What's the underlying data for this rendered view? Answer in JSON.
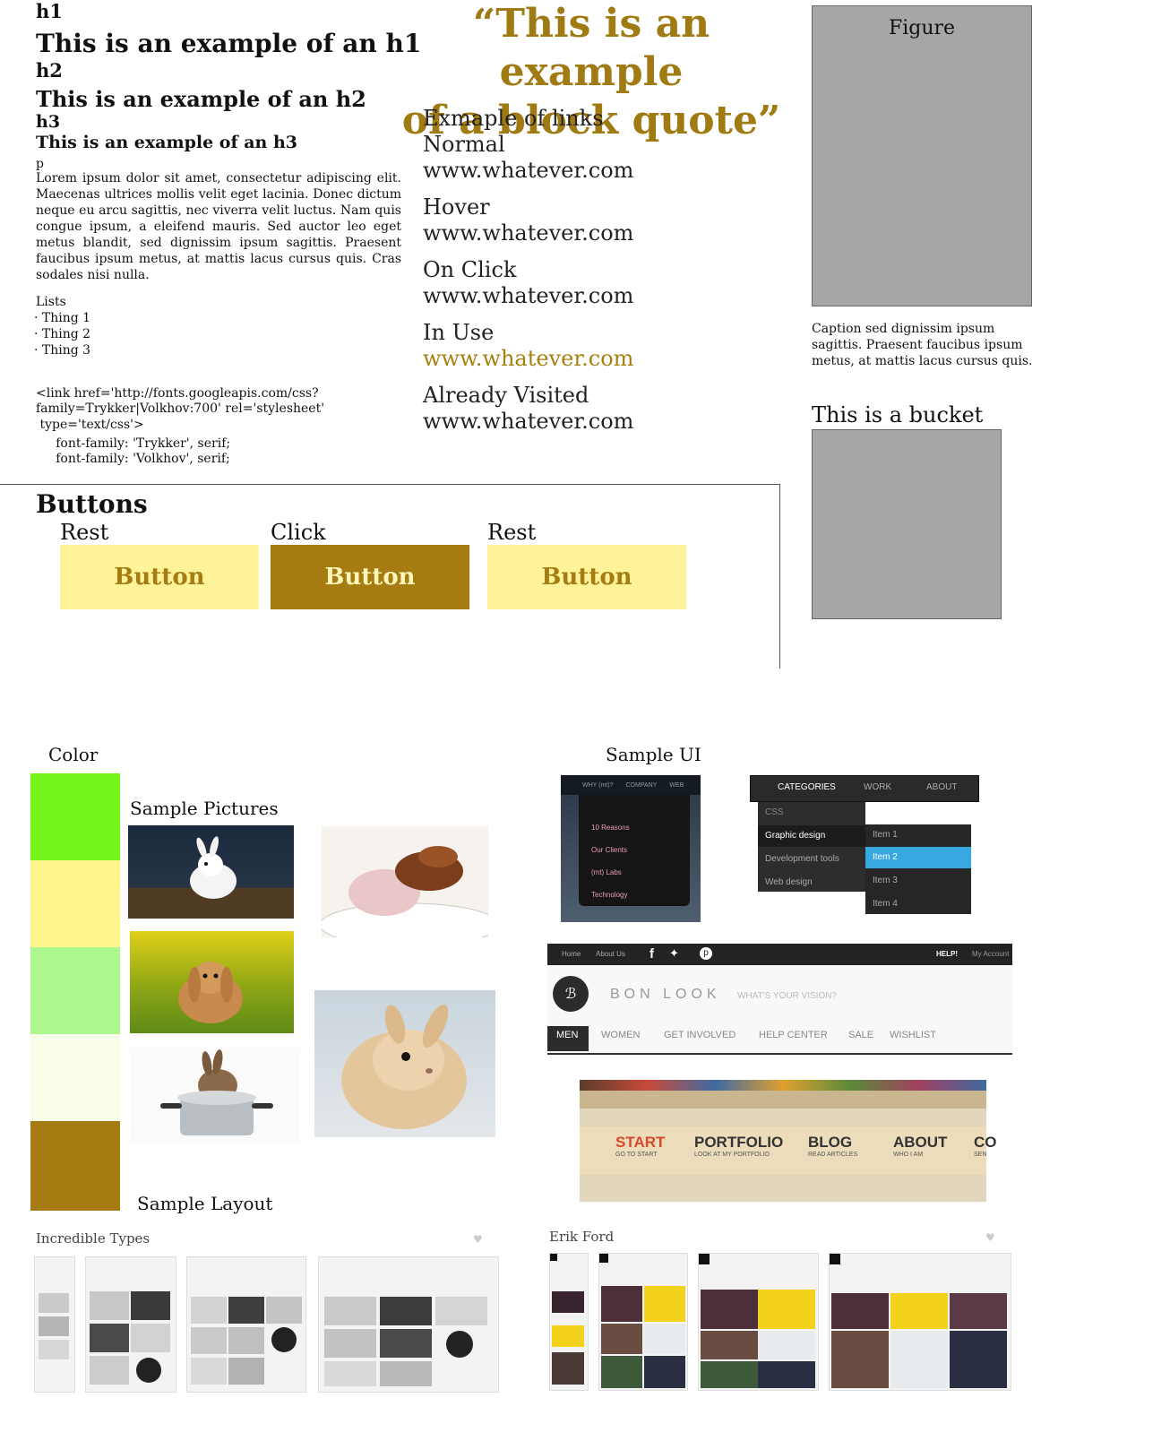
{
  "typography": {
    "h1_label": "h1",
    "h1_example": "This is an example of an h1",
    "h2_label": "h2",
    "h2_example": "This is an example of an h2",
    "h3_label": "h3",
    "h3_example": "This is an example of an h3",
    "p_label": "p",
    "paragraph": "Lorem ipsum dolor sit amet, consectetur adipiscing elit. Maecenas ultrices mollis velit eget lacinia. Donec dictum neque eu arcu sagittis, nec viverra velit luctus. Nam quis congue ipsum, a eleifend mauris. Sed auctor leo eget metus blandit, sed dignissim ipsum sagittis. Praesent faucibus ipsum metus, at mattis lacus cursus quis. Cras sodales nisi nulla.",
    "lists_label": "Lists",
    "list_items": [
      "· Thing 1",
      "· Thing 2",
      "· Thing 3"
    ],
    "code_lines": [
      "<link href='http://fonts.googleapis.com/css?",
      "family=Trykker|Volkhov:700' rel='stylesheet'",
      " type='text/css'>",
      "     font-family: 'Trykker', serif;",
      "     font-family: 'Volkhov', serif;"
    ]
  },
  "quote": {
    "line1": "“This is an example",
    "line2": "of a block quote”"
  },
  "links": {
    "heading": "Exmaple of links",
    "states": [
      {
        "label": "Normal",
        "url": "www.whatever.com"
      },
      {
        "label": "Hover",
        "url": "www.whatever.com"
      },
      {
        "label": "On Click",
        "url": "www.whatever.com"
      },
      {
        "label": "In Use",
        "url": "www.whatever.com"
      },
      {
        "label": "Already Visited",
        "url": "www.whatever.com"
      }
    ]
  },
  "figure": {
    "label": "Figure",
    "caption": "Caption sed dignissim ipsum sagittis. Praesent faucibus ipsum metus, at mattis lacus cursus quis.",
    "bucket_title": "This is a bucket"
  },
  "buttons": {
    "heading": "Buttons",
    "items": [
      {
        "state": "Rest",
        "label": "Button"
      },
      {
        "state": "Click",
        "label": "Button"
      },
      {
        "state": "Rest",
        "label": "Button"
      }
    ],
    "colors": {
      "rest_bg": "#fff399",
      "rest_text": "#a57c13",
      "click_bg": "#a67c12",
      "click_text": "#fff6b8"
    }
  },
  "color": {
    "label": "Color",
    "swatches": [
      "#74f51a",
      "#fff58f",
      "#adf78f",
      "#f8fde9",
      "#a67c12"
    ]
  },
  "pictures": {
    "label": "Sample Pictures"
  },
  "sample_ui": {
    "label": "Sample UI",
    "dropdown1": {
      "tabs": [
        "WHY (mt)?",
        "COMPANY",
        "WEB"
      ],
      "items": [
        "10 Reasons",
        "Our Clients",
        "(mt) Labs",
        "Technology"
      ]
    },
    "dropdown2": {
      "tabs": [
        "CATEGORIES",
        "WORK",
        "ABOUT"
      ],
      "items": [
        "CSS",
        "Graphic design",
        "Development tools",
        "Web design"
      ],
      "sub_items": [
        "Item 1",
        "Item 2",
        "Item 3",
        "Item 4"
      ]
    },
    "bonlook": {
      "top_links": [
        "Home",
        "About Us"
      ],
      "right_links": [
        "HELP!",
        "My Account"
      ],
      "brand": "BON LOOK",
      "tagline": "WHAT'S YOUR VISION?",
      "nav": [
        "MEN",
        "WOMEN",
        "GET INVOLVED",
        "HELP CENTER",
        "SALE",
        "WISHLIST"
      ]
    },
    "paper_nav": [
      {
        "title": "START",
        "sub": "GO TO START"
      },
      {
        "title": "PORTFOLIO",
        "sub": "LOOK AT MY PORTFOLIO"
      },
      {
        "title": "BLOG",
        "sub": "READ ARTICLES"
      },
      {
        "title": "ABOUT",
        "sub": "WHO I AM"
      },
      {
        "title": "CO",
        "sub": "SEN"
      }
    ]
  },
  "layout": {
    "label": "Sample Layout",
    "left_title": "Incredible Types",
    "right_title": "Erik Ford"
  }
}
